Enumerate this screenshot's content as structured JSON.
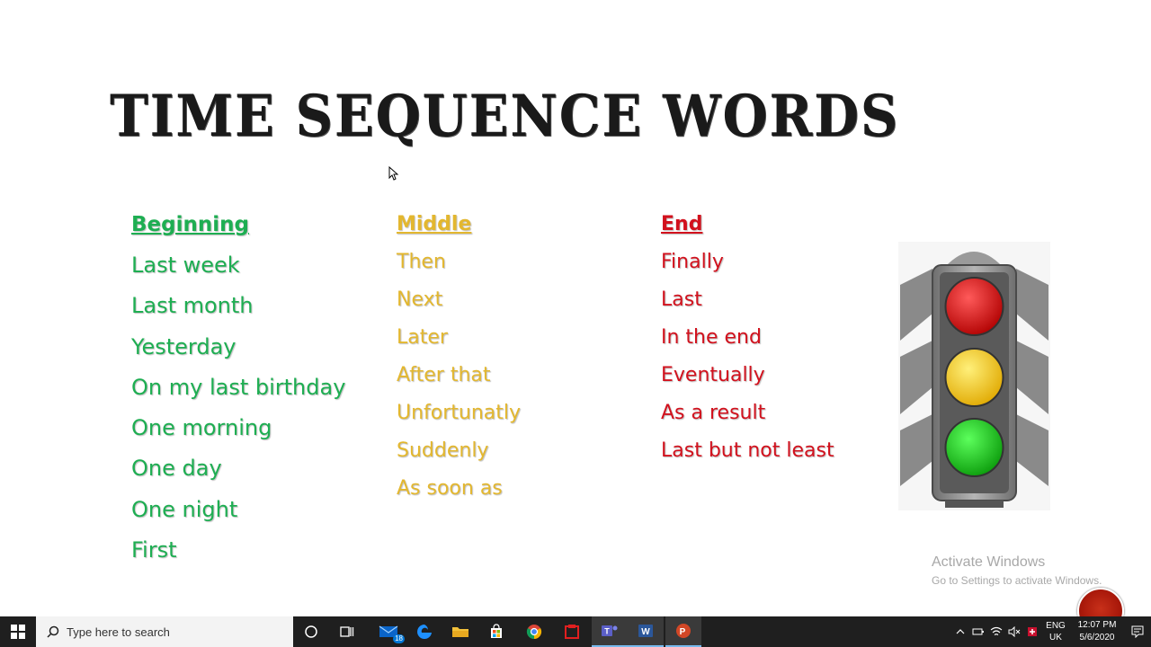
{
  "slide": {
    "title": "TIME SEQUENCE WORDS",
    "columns": [
      {
        "heading": "Beginning",
        "items": [
          "Last week",
          "Last month",
          "Yesterday",
          "On my last birthday",
          "One morning",
          "One day",
          "One night",
          "First"
        ]
      },
      {
        "heading": "Middle",
        "items": [
          "Then",
          "Next",
          "Later",
          "After that",
          "Unfortunatly",
          "Suddenly",
          "As soon as"
        ]
      },
      {
        "heading": "End",
        "items": [
          "Finally",
          "Last",
          "In the end",
          "Eventually",
          "As a result",
          "Last but not least"
        ]
      }
    ],
    "colors": {
      "beginning": "#1eae52",
      "middle": "#e3b72f",
      "end": "#d2111d"
    }
  },
  "watermark": {
    "line1": "Activate Windows",
    "line2": "Go to Settings to activate Windows."
  },
  "taskbar": {
    "search_placeholder": "Type here to search",
    "mail_badge": "18",
    "language": "ENG",
    "region": "UK",
    "time": "12:07 PM",
    "date": "5/6/2020",
    "apps": [
      "cortana-icon",
      "task-view-icon",
      "mail-icon",
      "edge-icon",
      "file-explorer-icon",
      "store-icon",
      "chrome-icon",
      "app-icon",
      "teams-icon",
      "word-icon",
      "powerpoint-icon"
    ]
  }
}
